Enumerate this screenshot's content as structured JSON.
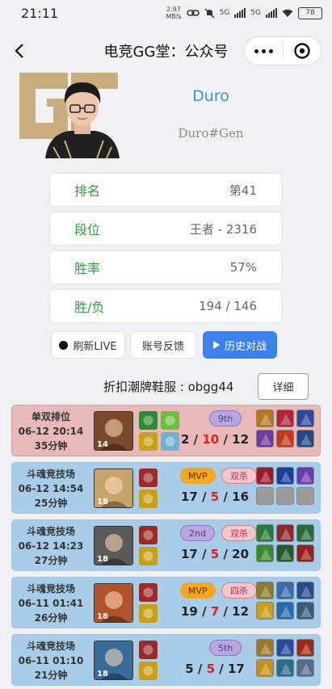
{
  "status_bar": {
    "time": "21:11",
    "speed_value": "2.97",
    "speed_unit": "MB/s",
    "network1": "5G",
    "network2": "5G",
    "battery": "78"
  },
  "nav": {
    "title": "电竞GG堂：公众号"
  },
  "profile": {
    "name": "Duro",
    "tag": "Duro#Gen",
    "colors": {
      "logo": "#c8ad7f",
      "name": "#3d8fe0"
    }
  },
  "stats": [
    {
      "label": "排名",
      "value": "第41"
    },
    {
      "label": "段位",
      "value": "王者 - 2316"
    },
    {
      "label": "胜率",
      "value": "57%"
    },
    {
      "label": "胜/负",
      "value": "194 / 146"
    }
  ],
  "actions": {
    "refresh": "刷新LIVE",
    "feedback": "账号反馈",
    "history": "历史对战"
  },
  "promo": {
    "text": "折扣潮牌鞋服 : obgg44",
    "detail": "详细"
  },
  "matches": [
    {
      "result": "loss",
      "mode": "单双排位",
      "date": "06-12 20:14",
      "duration": "35分钟",
      "champ_level": "14",
      "champ_color": "#7a4a2a",
      "spell_colors": [
        "#2f8a32",
        "#c7a019"
      ],
      "rune_colors": [
        "#6bbf3c",
        "#6fb2cf"
      ],
      "placement": "9th",
      "placement_type": "rank",
      "multikill": "",
      "kills": "2",
      "deaths": "10",
      "assists": "12",
      "items": [
        "#b07a22",
        "#b2243a",
        "#2b4a9a",
        "#6b3c9c",
        "#c23a1c",
        "#1e4a86"
      ]
    },
    {
      "result": "win",
      "mode": "斗魂竞技场",
      "date": "06-12 14:54",
      "duration": "25分钟",
      "champ_level": "18",
      "champ_color": "#c9a46a",
      "spell_colors": [
        "#9a2b2b",
        "#c7a019"
      ],
      "rune_colors": [],
      "placement": "MVP",
      "placement_type": "mvp",
      "multikill": "双杀",
      "kills": "17",
      "deaths": "5",
      "assists": "16",
      "items": [
        "#9a1c2c",
        "#1c3c9a",
        "#6a3caa",
        "",
        "",
        ""
      ]
    },
    {
      "result": "win",
      "mode": "斗魂竞技场",
      "date": "06-12 14:23",
      "duration": "27分钟",
      "champ_level": "18",
      "champ_color": "#5a5a5a",
      "spell_colors": [
        "#9a2b2b",
        "#c7a019"
      ],
      "rune_colors": [],
      "placement": "2nd",
      "placement_type": "rank",
      "multikill": "双杀",
      "kills": "17",
      "deaths": "5",
      "assists": "20",
      "items": [
        "#2a7a3a",
        "#8a2a2a",
        "#2a6a3a",
        "#3a8a2a",
        "#2a5a2a",
        "#9a1c1c"
      ]
    },
    {
      "result": "win",
      "mode": "斗魂竞技场",
      "date": "06-11 01:41",
      "duration": "26分钟",
      "champ_level": "18",
      "champ_color": "#b0552a",
      "spell_colors": [
        "#9a2b2b",
        "#c7a019"
      ],
      "rune_colors": [],
      "placement": "MVP",
      "placement_type": "mvp",
      "multikill": "四杀",
      "kills": "19",
      "deaths": "7",
      "assists": "12",
      "items": [
        "#8a7a2a",
        "#3a6aaa",
        "#2a4a8a",
        "#c7a019",
        "#2a6aaa",
        "#3a5a7a"
      ]
    },
    {
      "result": "win",
      "mode": "斗魂竞技场",
      "date": "06-11 01:10",
      "duration": "21分钟",
      "champ_level": "18",
      "champ_color": "#3a6a9a",
      "spell_colors": [
        "#9a2b2b",
        "#c7a019"
      ],
      "rune_colors": [],
      "placement": "5th",
      "placement_type": "rank",
      "multikill": "",
      "kills": "5",
      "deaths": "5",
      "assists": "17",
      "items": [
        "#9a7a2a",
        "#2a4a9a",
        "#9a2a1a",
        "#c79019",
        "#2a6a8a",
        "#5a6a8a"
      ]
    }
  ]
}
